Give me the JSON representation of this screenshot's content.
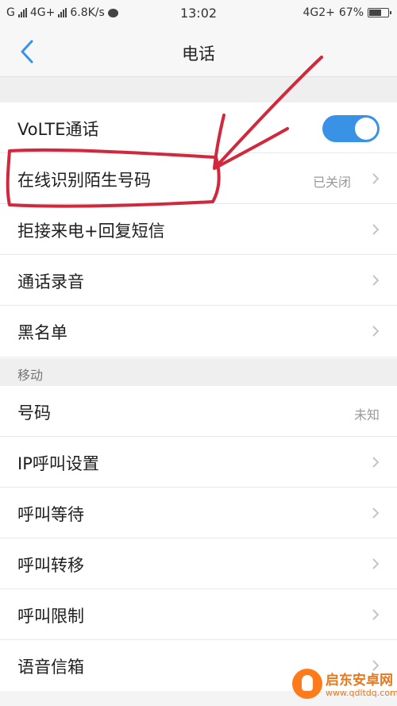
{
  "status_bar": {
    "carrier1": "G",
    "network": "4G+",
    "speed": "6.8K/s",
    "time": "13:02",
    "network_right": "4G2+",
    "battery": "67%"
  },
  "header": {
    "title": "电话"
  },
  "group1": {
    "volte_label": "VoLTE通话",
    "volte_enabled": true,
    "items": [
      {
        "label": "在线识别陌生号码",
        "value": "已关闭"
      },
      {
        "label": "拒接来电+回复短信",
        "value": ""
      },
      {
        "label": "通话录音",
        "value": ""
      },
      {
        "label": "黑名单",
        "value": ""
      }
    ]
  },
  "section2": {
    "title": "移动",
    "items": [
      {
        "label": "号码",
        "value": "未知"
      },
      {
        "label": "IP呼叫设置",
        "value": ""
      },
      {
        "label": "呼叫等待",
        "value": ""
      },
      {
        "label": "呼叫转移",
        "value": ""
      },
      {
        "label": "呼叫限制",
        "value": ""
      },
      {
        "label": "语音信箱",
        "value": ""
      }
    ]
  },
  "watermark": {
    "name": "启东安卓网",
    "url": "www.qdltdq.com"
  },
  "colors": {
    "accent": "#3a92e6",
    "annotation": "#d0283c",
    "watermark": "#e67820"
  }
}
